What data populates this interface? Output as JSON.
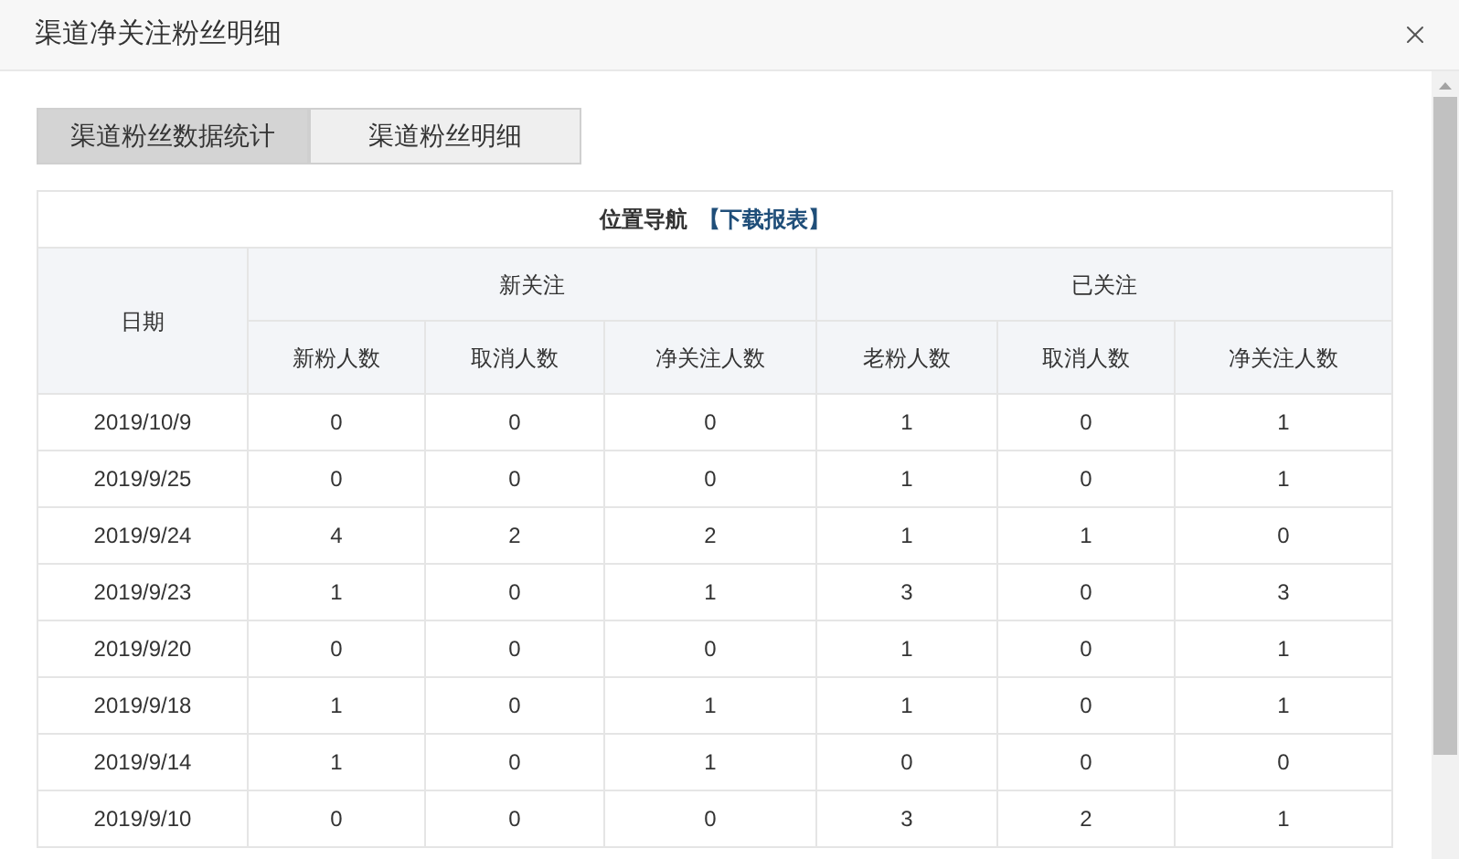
{
  "window": {
    "title": "渠道净关注粉丝明细"
  },
  "tabs": [
    {
      "label": "渠道粉丝数据统计",
      "selected": true
    },
    {
      "label": "渠道粉丝明细",
      "selected": false
    }
  ],
  "nav": {
    "label": "位置导航",
    "link_open": "【",
    "link": "下载报表",
    "link_close": "】"
  },
  "table": {
    "date_column": "日期",
    "groups": [
      {
        "label": "新关注",
        "columns": [
          "新粉人数",
          "取消人数",
          "净关注人数"
        ]
      },
      {
        "label": "已关注",
        "columns": [
          "老粉人数",
          "取消人数",
          "净关注人数"
        ]
      }
    ],
    "rows": [
      [
        "2019/10/9",
        "0",
        "0",
        "0",
        "1",
        "0",
        "1"
      ],
      [
        "2019/9/25",
        "0",
        "0",
        "0",
        "1",
        "0",
        "1"
      ],
      [
        "2019/9/24",
        "4",
        "2",
        "2",
        "1",
        "1",
        "0"
      ],
      [
        "2019/9/23",
        "1",
        "0",
        "1",
        "3",
        "0",
        "3"
      ],
      [
        "2019/9/20",
        "0",
        "0",
        "0",
        "1",
        "0",
        "1"
      ],
      [
        "2019/9/18",
        "1",
        "0",
        "1",
        "1",
        "0",
        "1"
      ],
      [
        "2019/9/14",
        "1",
        "0",
        "1",
        "0",
        "0",
        "0"
      ],
      [
        "2019/9/10",
        "0",
        "0",
        "0",
        "3",
        "2",
        "1"
      ]
    ]
  }
}
